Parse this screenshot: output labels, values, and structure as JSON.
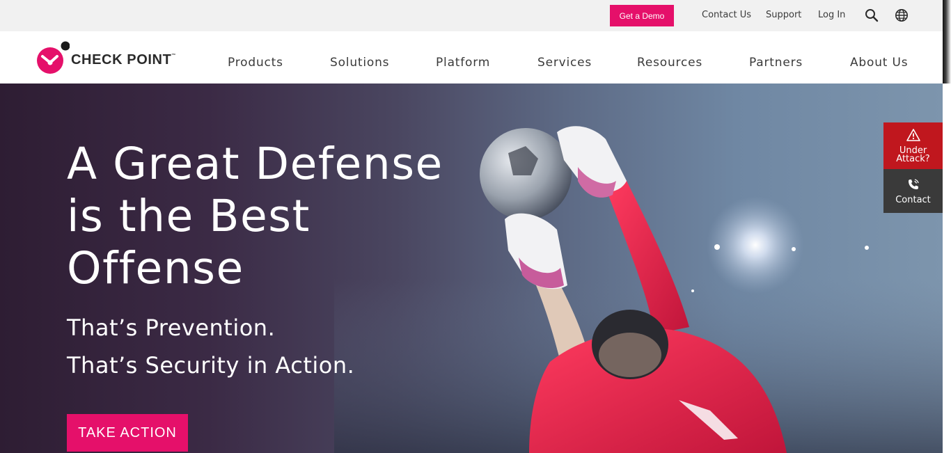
{
  "utility": {
    "demo_label": "Get a Demo",
    "contact_label": "Contact Us",
    "support_label": "Support",
    "login_label": "Log In"
  },
  "logo": {
    "text": "CHECK POINT",
    "tm": "™"
  },
  "nav": {
    "items": [
      {
        "label": "Products"
      },
      {
        "label": "Solutions"
      },
      {
        "label": "Platform"
      },
      {
        "label": "Services"
      },
      {
        "label": "Resources"
      },
      {
        "label": "Partners"
      },
      {
        "label": "About Us"
      }
    ]
  },
  "hero": {
    "title": "A Great Defense is the Best Offense",
    "subtitle_1": "That’s Prevention.",
    "subtitle_2": "That’s Security in Action.",
    "cta_label": "TAKE ACTION"
  },
  "widgets": {
    "attack_label_1": "Under",
    "attack_label_2": "Attack?",
    "contact_label": "Contact"
  },
  "colors": {
    "brand_pink": "#e5106a",
    "attack_red": "#c0171e",
    "contact_gray": "#3a3a3a"
  },
  "icons": [
    "search-icon",
    "globe-icon",
    "warning-icon",
    "phone-icon"
  ]
}
